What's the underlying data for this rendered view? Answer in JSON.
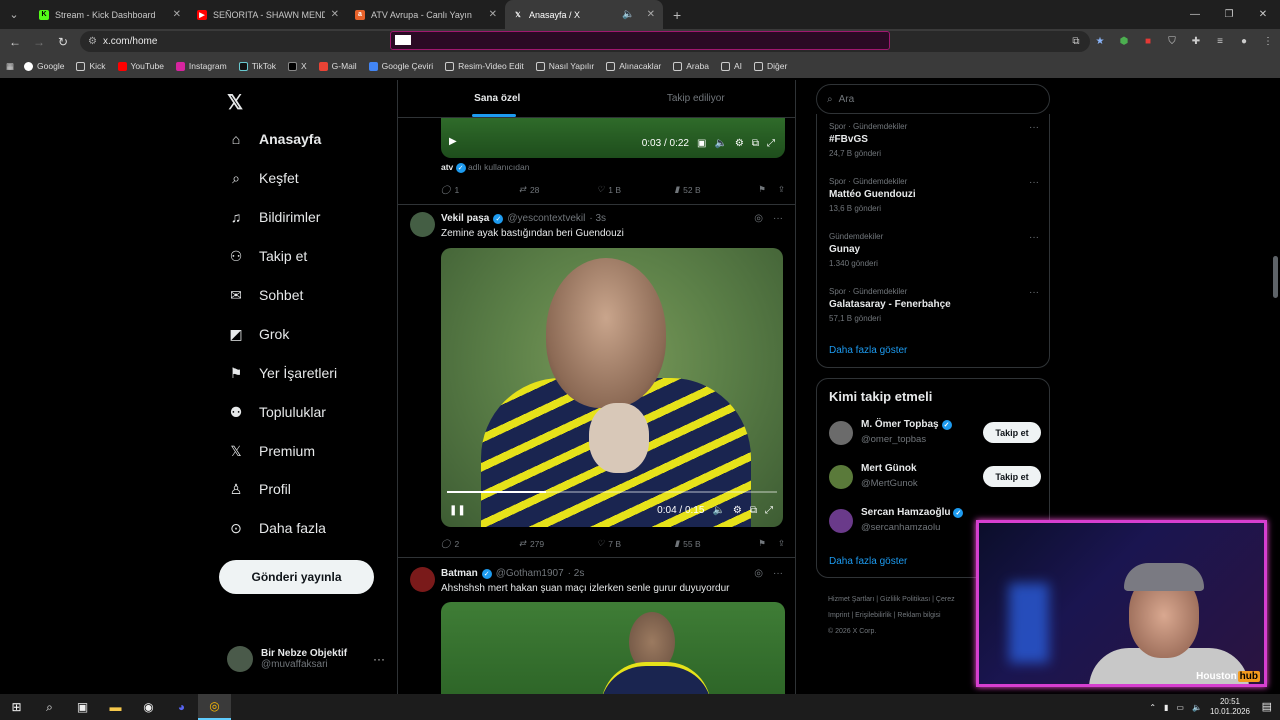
{
  "browser": {
    "tabs": [
      {
        "title": "Stream - Kick Dashboard",
        "icon": "kick-icon",
        "color": "#53fc18"
      },
      {
        "title": "SEÑORITA - SHAWN MENDES, C",
        "icon": "youtube-icon",
        "color": "#ff0000"
      },
      {
        "title": "ATV Avrupa - Canlı Yayın",
        "icon": "atv-icon",
        "color": "#e8622a"
      },
      {
        "title": "Anasayfa / X",
        "icon": "x-icon",
        "color": "#ffffff"
      }
    ],
    "url": "x.com/home",
    "bookmarks": [
      "Google",
      "Kick",
      "YouTube",
      "Instagram",
      "TikTok",
      "X",
      "G-Mail",
      "Google Çeviri",
      "Resim-Video Edit",
      "Nasıl Yapılır",
      "Alınacaklar",
      "Araba",
      "AI",
      "Diğer"
    ]
  },
  "nav": {
    "items": [
      "Anasayfa",
      "Keşfet",
      "Bildirimler",
      "Takip et",
      "Sohbet",
      "Grok",
      "Yer İşaretleri",
      "Topluluklar",
      "Premium",
      "Profil",
      "Daha fazla"
    ],
    "post_button": "Gönderi yayınla",
    "profile_name": "Bir Nebze Objektif",
    "profile_handle": "@muvaffaksari"
  },
  "timeline": {
    "tabs": [
      "Sana özel",
      "Takip ediliyor"
    ],
    "video1": {
      "time": "0:03 / 0:22",
      "credit_name": "atv",
      "credit_text": "adlı kullanıcıdan"
    },
    "post1_stats": {
      "replies": "1",
      "reposts": "28",
      "likes": "1 B",
      "views": "52 B"
    },
    "post2": {
      "name": "Vekil paşa",
      "handle": "@yescontextvekil",
      "time": "· 3s",
      "text": "Zemine ayak bastığından beri Guendouzi",
      "video_time": "0:04 / 0:15",
      "video_progress": 0.3,
      "stats": {
        "replies": "2",
        "reposts": "279",
        "likes": "7 B",
        "views": "55 B"
      }
    },
    "post3": {
      "name": "Batman",
      "handle": "@Gotham1907",
      "time": "· 2s",
      "text": "Ahshshsh mert hakan şuan maçı izlerken senle gurur duyuyordur"
    }
  },
  "right": {
    "search_placeholder": "Ara",
    "trends": [
      {
        "category": "Spor · Gündemdekiler",
        "name": "#FBvGS",
        "posts": "24,7 B gönderi"
      },
      {
        "category": "Spor · Gündemdekiler",
        "name": "Mattéo Guendouzi",
        "posts": "13,6 B gönderi"
      },
      {
        "category": "Gündemdekiler",
        "name": "Gunay",
        "posts": "1.340 gönderi"
      },
      {
        "category": "Spor · Gündemdekiler",
        "name": "Galatasaray - Fenerbahçe",
        "posts": "57,1 B gönderi"
      }
    ],
    "show_more": "Daha fazla göster",
    "who_to_follow_title": "Kimi takip etmeli",
    "who_to_follow": [
      {
        "name": "M. Ömer Topbaş",
        "handle": "@omer_topbas"
      },
      {
        "name": "Mert Günok",
        "handle": "@MertGunok"
      },
      {
        "name": "Sercan Hamzaoğlu",
        "handle": "@sercanhamzaolu"
      }
    ],
    "follow_label": "Takip et",
    "footer": [
      "Hizmet Şartları",
      "Gizlilik Politikası",
      "Çerez",
      "Imprint",
      "Erişilebilirlik",
      "Reklam bilgisi",
      "© 2026 X Corp."
    ]
  },
  "overlay": {
    "brand": "Houston",
    "brand_tag": "hub"
  },
  "taskbar": {
    "time": "20:51",
    "date": "10.01.2026"
  }
}
